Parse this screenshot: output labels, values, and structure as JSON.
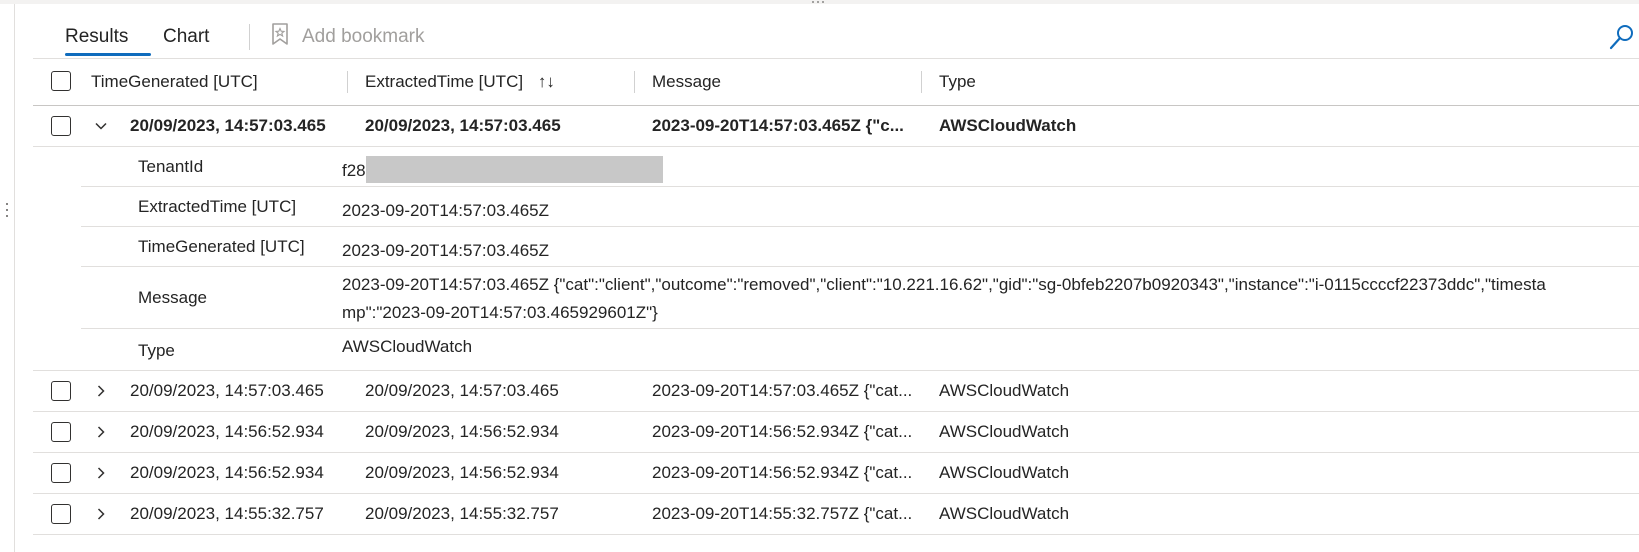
{
  "tabs": {
    "results": "Results",
    "chart": "Chart",
    "add_bookmark": "Add bookmark"
  },
  "columns": {
    "time_generated": "TimeGenerated [UTC]",
    "extracted_time": "ExtractedTime [UTC]",
    "sort_indicator": "↑↓",
    "message": "Message",
    "type": "Type"
  },
  "expanded_row": {
    "time_generated": "20/09/2023, 14:57:03.465",
    "extracted_time": "20/09/2023, 14:57:03.465",
    "message": "2023-09-20T14:57:03.465Z {\"c...",
    "type": "AWSCloudWatch"
  },
  "details": {
    "tenant_key": "TenantId",
    "tenant_value": "f28",
    "extracted_key": "ExtractedTime [UTC]",
    "extracted_value": "2023-09-20T14:57:03.465Z",
    "generated_key": "TimeGenerated [UTC]",
    "generated_value": "2023-09-20T14:57:03.465Z",
    "message_key": "Message",
    "message_value": "2023-09-20T14:57:03.465Z {\"cat\":\"client\",\"outcome\":\"removed\",\"client\":\"10.221.16.62\",\"gid\":\"sg-0bfeb2207b0920343\",\"instance\":\"i-0115ccccf22373ddc\",\"timestamp\":\"2023-09-20T14:57:03.465929601Z\"}",
    "type_key": "Type",
    "type_value": "AWSCloudWatch"
  },
  "rows": [
    {
      "time_generated": "20/09/2023, 14:57:03.465",
      "extracted_time": "20/09/2023, 14:57:03.465",
      "message": "2023-09-20T14:57:03.465Z {\"cat...",
      "type": "AWSCloudWatch"
    },
    {
      "time_generated": "20/09/2023, 14:56:52.934",
      "extracted_time": "20/09/2023, 14:56:52.934",
      "message": "2023-09-20T14:56:52.934Z {\"cat...",
      "type": "AWSCloudWatch"
    },
    {
      "time_generated": "20/09/2023, 14:56:52.934",
      "extracted_time": "20/09/2023, 14:56:52.934",
      "message": "2023-09-20T14:56:52.934Z {\"cat...",
      "type": "AWSCloudWatch"
    },
    {
      "time_generated": "20/09/2023, 14:55:32.757",
      "extracted_time": "20/09/2023, 14:55:32.757",
      "message": "2023-09-20T14:55:32.757Z {\"cat...",
      "type": "AWSCloudWatch"
    }
  ],
  "colors": {
    "accent": "#0f6cbd",
    "redaction": "#c8c8c8"
  }
}
